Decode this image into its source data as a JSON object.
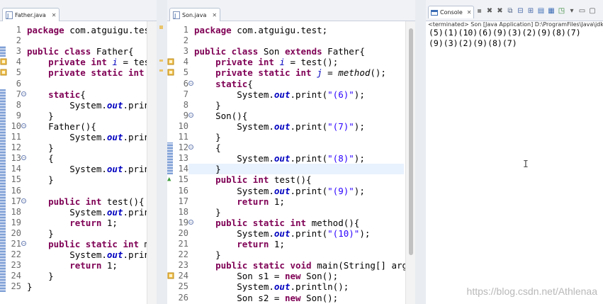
{
  "father_editor": {
    "tab_title": "Father.java",
    "lines": [
      {
        "n": "1",
        "html": "<span class=\"kw\">package</span> com.atguigu.test;"
      },
      {
        "n": "2",
        "html": ""
      },
      {
        "n": "3",
        "html": "<span class=\"kw\">public class</span> Father{"
      },
      {
        "n": "4",
        "html": "    <span class=\"kw\">private int</span> <span class=\"fld\">i</span> = test("
      },
      {
        "n": "5",
        "html": "    <span class=\"kw\">private static int</span> <span class=\"fld\">j</span> ="
      },
      {
        "n": "6",
        "html": ""
      },
      {
        "n": "7",
        "html": "    <span class=\"kw\">static</span>{"
      },
      {
        "n": "8",
        "html": "        System.<span class=\"stat\">out</span>.print(\""
      },
      {
        "n": "9",
        "html": "    }"
      },
      {
        "n": "10",
        "html": "    Father(){"
      },
      {
        "n": "11",
        "html": "        System.<span class=\"stat\">out</span>.print(\""
      },
      {
        "n": "12",
        "html": "    }"
      },
      {
        "n": "13",
        "html": "    {"
      },
      {
        "n": "14",
        "html": "        System.<span class=\"stat\">out</span>.print(\""
      },
      {
        "n": "15",
        "html": "    }"
      },
      {
        "n": "16",
        "html": ""
      },
      {
        "n": "17",
        "html": "    <span class=\"kw\">public int</span> test(){"
      },
      {
        "n": "18",
        "html": "        System.<span class=\"stat\">out</span>.print(\""
      },
      {
        "n": "19",
        "html": "        <span class=\"kw\">return</span> 1;"
      },
      {
        "n": "20",
        "html": "    }"
      },
      {
        "n": "21",
        "html": "    <span class=\"kw\">public static int</span> meth"
      },
      {
        "n": "22",
        "html": "        System.<span class=\"stat\">out</span>.print(\""
      },
      {
        "n": "23",
        "html": "        <span class=\"kw\">return</span> 1;"
      },
      {
        "n": "24",
        "html": "    }"
      },
      {
        "n": "25",
        "html": "}"
      }
    ]
  },
  "son_editor": {
    "tab_title": "Son.java",
    "lines": [
      {
        "n": "1",
        "html": "<span class=\"kw\">package</span> com.atguigu.test;"
      },
      {
        "n": "2",
        "html": ""
      },
      {
        "n": "3",
        "html": "<span class=\"kw\">public class</span> Son <span class=\"kw\">extends</span> Father{"
      },
      {
        "n": "4",
        "html": "    <span class=\"kw\">private int</span> <span class=\"fld\">i</span> = test();"
      },
      {
        "n": "5",
        "html": "    <span class=\"kw\">private static int</span> <span class=\"fld\">j</span> = <span class=\"mt\">method</span>();"
      },
      {
        "n": "6",
        "html": "    <span class=\"kw\">static</span>{"
      },
      {
        "n": "7",
        "html": "        System.<span class=\"stat\">out</span>.print(<span class=\"str\">\"(6)\"</span>);"
      },
      {
        "n": "8",
        "html": "    }"
      },
      {
        "n": "9",
        "html": "    Son(){"
      },
      {
        "n": "10",
        "html": "        System.<span class=\"stat\">out</span>.print(<span class=\"str\">\"(7)\"</span>);"
      },
      {
        "n": "11",
        "html": "    }"
      },
      {
        "n": "12",
        "html": "    {"
      },
      {
        "n": "13",
        "html": "        System.<span class=\"stat\">out</span>.print(<span class=\"str\">\"(8)\"</span>);"
      },
      {
        "n": "14",
        "html": "    }"
      },
      {
        "n": "15",
        "html": "    <span class=\"kw\">public int</span> test(){"
      },
      {
        "n": "16",
        "html": "        System.<span class=\"stat\">out</span>.print(<span class=\"str\">\"(9)\"</span>);"
      },
      {
        "n": "17",
        "html": "        <span class=\"kw\">return</span> 1;"
      },
      {
        "n": "18",
        "html": "    }"
      },
      {
        "n": "19",
        "html": "    <span class=\"kw\">public static int</span> method(){"
      },
      {
        "n": "20",
        "html": "        System.<span class=\"stat\">out</span>.print(<span class=\"str\">\"(10)\"</span>);"
      },
      {
        "n": "21",
        "html": "        <span class=\"kw\">return</span> 1;"
      },
      {
        "n": "22",
        "html": "    }"
      },
      {
        "n": "23",
        "html": "    <span class=\"kw\">public static void</span> main(String[] args) {"
      },
      {
        "n": "24",
        "html": "        Son s1 = <span class=\"kw\">new</span> Son();"
      },
      {
        "n": "25",
        "html": "        System.<span class=\"stat\">out</span>.println();"
      },
      {
        "n": "26",
        "html": "        Son s2 = <span class=\"kw\">new</span> Son();"
      }
    ]
  },
  "console": {
    "tab_title": "Console",
    "status": "<terminated> Son [Java Application] D:\\ProgramFiles\\Java\\jdk",
    "output_lines": [
      "(5)(1)(10)(6)(9)(3)(2)(9)(8)(7)",
      "(9)(3)(2)(9)(8)(7)"
    ],
    "toolbar_icons": [
      "remove-all-terminated-icon",
      "terminate-icon",
      "remove-launch-icon",
      "copy-icon",
      "scroll-lock-icon",
      "word-wrap-icon",
      "show-console-icon",
      "display-selected-console-icon",
      "open-console-icon",
      "view-menu-icon",
      "minimize-icon",
      "maximize-icon"
    ]
  },
  "watermark": "https://blog.csdn.net/Athlenaa",
  "colors": {
    "keyword": "#7f0055",
    "field": "#0000c0",
    "string": "#2a00ff",
    "current_line": "#e8f2fe"
  }
}
